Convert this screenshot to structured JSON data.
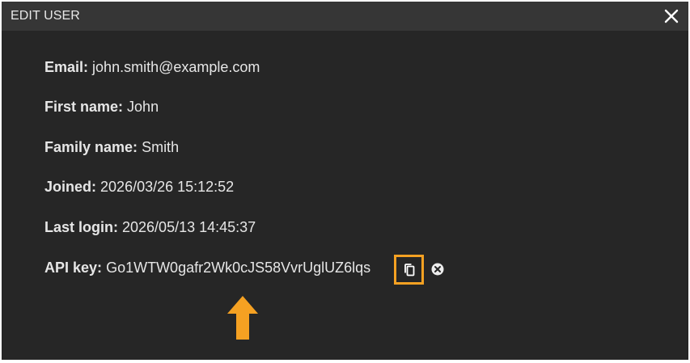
{
  "dialog": {
    "title": "EDIT USER",
    "close_icon": "close-icon"
  },
  "fields": {
    "email": {
      "label": "Email:",
      "value": "john.smith@example.com"
    },
    "first_name": {
      "label": "First name:",
      "value": "John"
    },
    "family_name": {
      "label": "Family name:",
      "value": "Smith"
    },
    "joined": {
      "label": "Joined:",
      "value": "2026/03/26 15:12:52"
    },
    "last_login": {
      "label": "Last login:",
      "value": "2026/05/13 14:45:37"
    },
    "api_key": {
      "label": "API key:",
      "value": "Go1WTW0gafr2Wk0cJS58VvrUglUZ6lqs",
      "copy_icon": "clipboard-icon",
      "clear_icon": "circle-x-icon"
    }
  },
  "annotation": {
    "arrow_icon": "arrow-up-icon",
    "highlight_color": "#f5a122",
    "arrow_color": "#f5a122"
  },
  "colors": {
    "dialog_bg": "#262626",
    "titlebar_bg": "#363636",
    "text": "#e6e6e6"
  }
}
